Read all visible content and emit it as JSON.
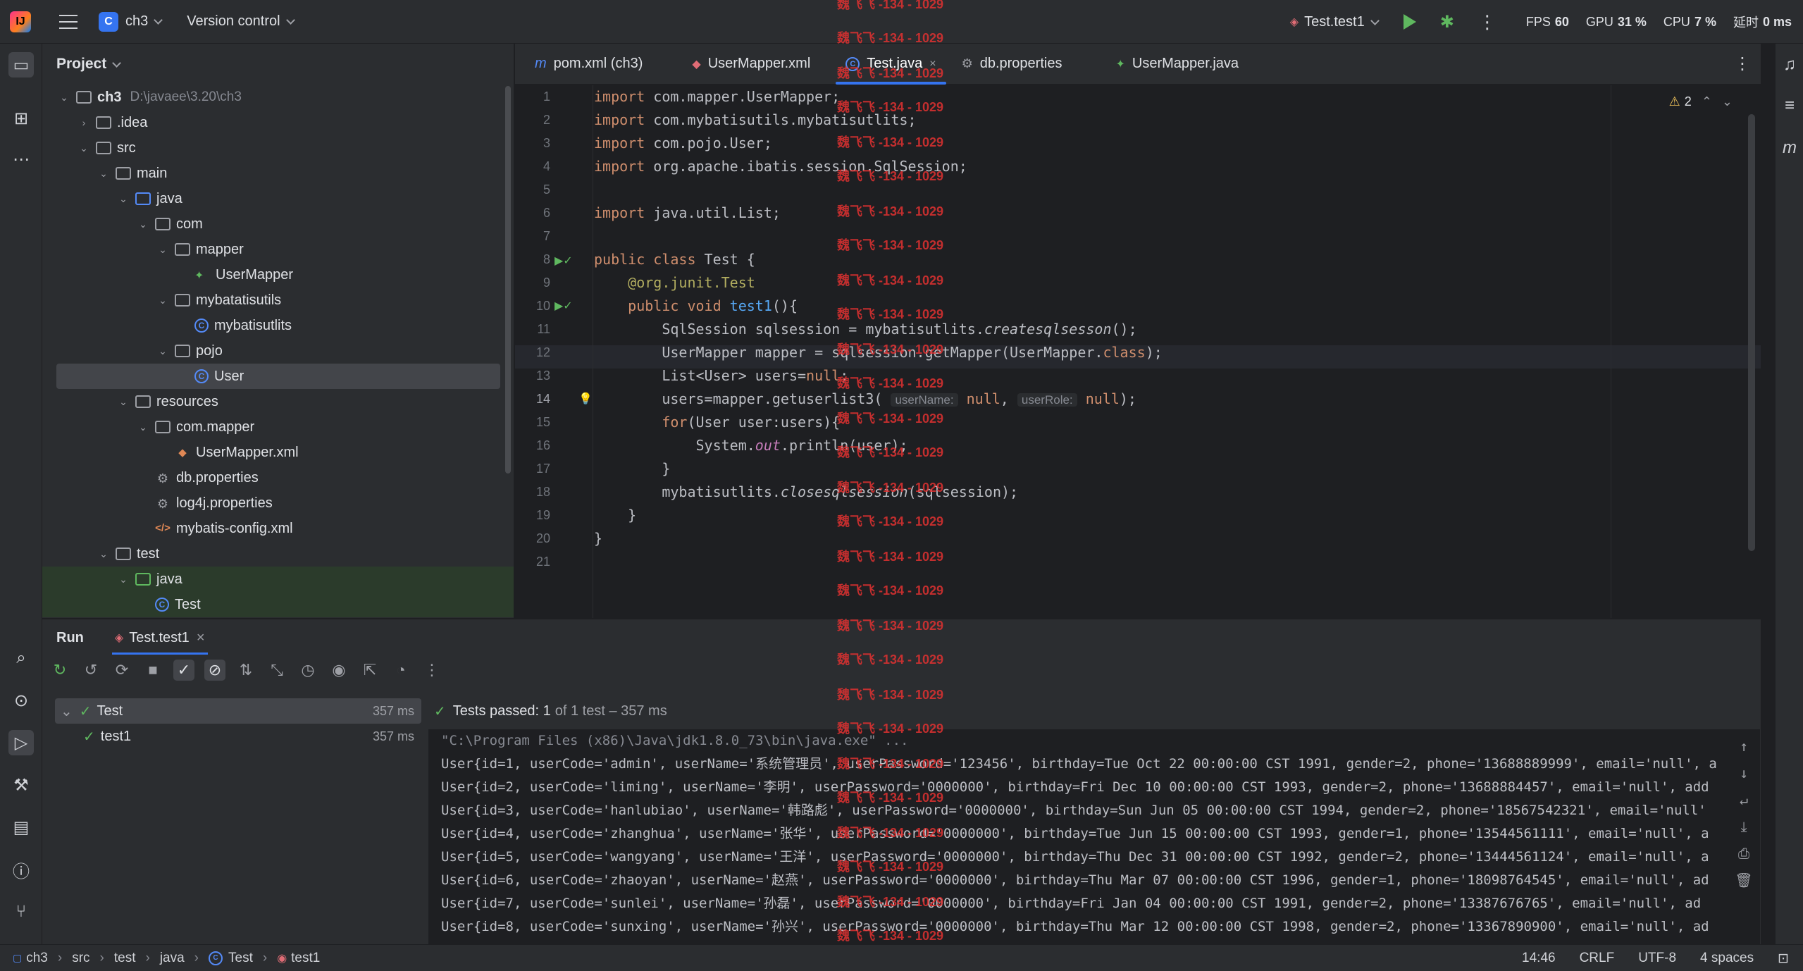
{
  "titlebar": {
    "project_name": "ch3",
    "project_badge": "C",
    "vcs_label": "Version control",
    "run_config": "Test.test1",
    "perf": {
      "fps_label": "FPS",
      "fps_value": "60",
      "gpu_label": "GPU",
      "gpu_value": "31 %",
      "cpu_label": "CPU",
      "cpu_value": "7 %",
      "delay_label": "延时",
      "delay_value": "0 ms"
    }
  },
  "project": {
    "header": "Project",
    "tree": [
      {
        "label": "ch3",
        "path": "D:\\javaee\\3.20\\ch3",
        "kind": "root"
      },
      {
        "label": ".idea",
        "kind": "folder"
      },
      {
        "label": "src",
        "kind": "folder"
      },
      {
        "label": "main",
        "kind": "folder"
      },
      {
        "label": "java",
        "kind": "source-folder"
      },
      {
        "label": "com",
        "kind": "package"
      },
      {
        "label": "mapper",
        "kind": "package"
      },
      {
        "label": "UserMapper",
        "kind": "interface"
      },
      {
        "label": "mybatatisutils",
        "kind": "package"
      },
      {
        "label": "mybatisutlits",
        "kind": "class"
      },
      {
        "label": "pojo",
        "kind": "package"
      },
      {
        "label": "User",
        "kind": "class"
      },
      {
        "label": "resources",
        "kind": "resources-folder"
      },
      {
        "label": "com.mapper",
        "kind": "package"
      },
      {
        "label": "UserMapper.xml",
        "kind": "xml-mapper"
      },
      {
        "label": "db.properties",
        "kind": "properties"
      },
      {
        "label": "log4j.properties",
        "kind": "properties"
      },
      {
        "label": "mybatis-config.xml",
        "kind": "xml"
      },
      {
        "label": "test",
        "kind": "folder"
      },
      {
        "label": "java",
        "kind": "test-folder"
      },
      {
        "label": "Test",
        "kind": "class"
      }
    ]
  },
  "editor": {
    "tabs": [
      {
        "label": "pom.xml (ch3)",
        "icon": "maven-icon"
      },
      {
        "label": "UserMapper.xml",
        "icon": "xml-icon"
      },
      {
        "label": "Test.java",
        "icon": "class-icon"
      },
      {
        "label": "db.properties",
        "icon": "gear-icon"
      },
      {
        "label": "UserMapper.java",
        "icon": "interface-icon"
      }
    ],
    "warnings_count": "2",
    "hint_username": "userName:",
    "hint_userrole": "userRole:",
    "line_numbers": [
      "1",
      "2",
      "3",
      "4",
      "5",
      "6",
      "7",
      "8",
      "9",
      "10",
      "11",
      "12",
      "13",
      "14",
      "15",
      "16",
      "17",
      "18",
      "19",
      "20",
      "21"
    ]
  },
  "run": {
    "title": "Run",
    "tab_label": "Test.test1",
    "tests": [
      {
        "name": "Test",
        "time": "357 ms"
      },
      {
        "name": "test1",
        "time": "357 ms"
      }
    ],
    "status_main": "Tests passed: 1",
    "status_detail": "of 1 test – 357 ms",
    "console": [
      "\"C:\\Program Files (x86)\\Java\\jdk1.8.0_73\\bin\\java.exe\" ...",
      "User{id=1, userCode='admin', userName='系统管理员', userPassword='123456', birthday=Tue Oct 22 00:00:00 CST 1991, gender=2, phone='13688889999', email='null', a",
      "User{id=2, userCode='liming', userName='李明', userPassword='0000000', birthday=Fri Dec 10 00:00:00 CST 1993, gender=2, phone='13688884457', email='null', add",
      "User{id=3, userCode='hanlubiao', userName='韩路彪', userPassword='0000000', birthday=Sun Jun 05 00:00:00 CST 1994, gender=2, phone='18567542321', email='null'",
      "User{id=4, userCode='zhanghua', userName='张华', userPassword='0000000', birthday=Tue Jun 15 00:00:00 CST 1993, gender=1, phone='13544561111', email='null', a",
      "User{id=5, userCode='wangyang', userName='王洋', userPassword='0000000', birthday=Thu Dec 31 00:00:00 CST 1992, gender=2, phone='13444561124', email='null', a",
      "User{id=6, userCode='zhaoyan', userName='赵燕', userPassword='0000000', birthday=Thu Mar 07 00:00:00 CST 1996, gender=1, phone='18098764545', email='null', ad",
      "User{id=7, userCode='sunlei', userName='孙磊', userPassword='0000000', birthday=Fri Jan 04 00:00:00 CST 1991, gender=2, phone='13387676765', email='null', ad",
      "User{id=8, userCode='sunxing', userName='孙兴', userPassword='0000000', birthday=Thu Mar 12 00:00:00 CST 1998, gender=2, phone='13367890900', email='null', ad"
    ]
  },
  "statusbar": {
    "breadcrumbs": [
      "ch3",
      "src",
      "test",
      "java",
      "Test",
      "test1"
    ],
    "position": "14:46",
    "line_sep": "CRLF",
    "encoding": "UTF-8",
    "indent": "4 spaces"
  },
  "watermark": "魏飞飞 -134 - 1029",
  "colors": {
    "accent": "#3574f0",
    "success": "#5fb85f",
    "watermark": "#e03131"
  }
}
